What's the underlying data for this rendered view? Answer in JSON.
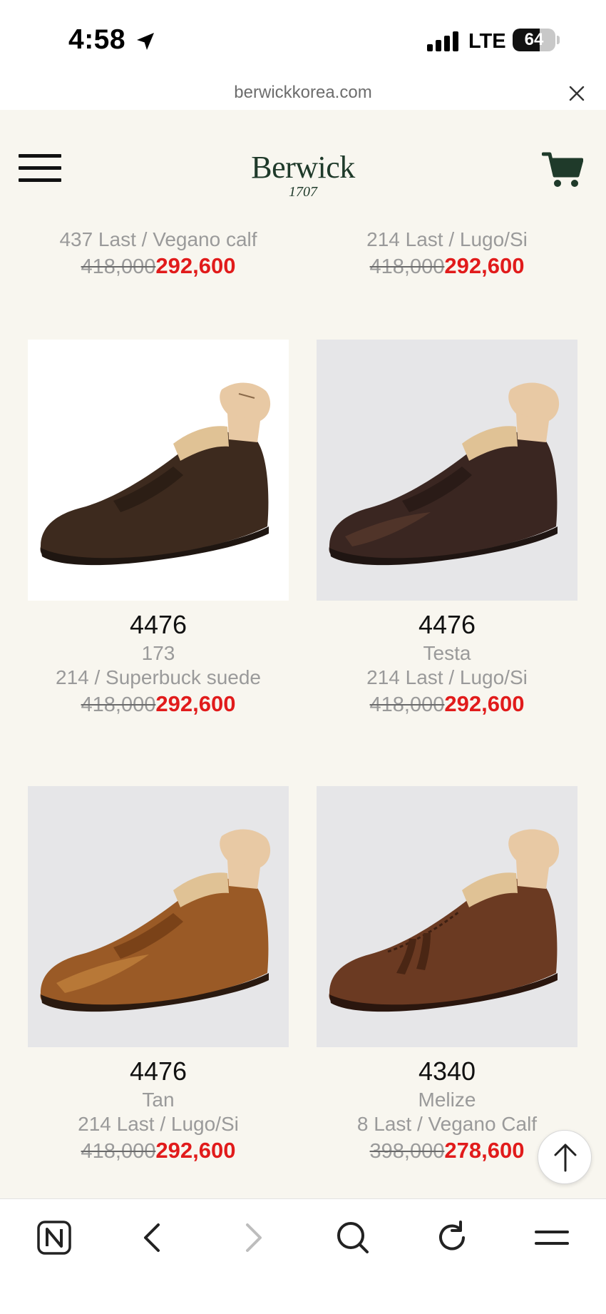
{
  "status_bar": {
    "time": "4:58",
    "network": "LTE",
    "battery": "64",
    "battery_level": 0.64
  },
  "browser": {
    "url": "berwickkorea.com"
  },
  "header": {
    "logo_main": "Berwick",
    "logo_sub": "1707"
  },
  "top_row": [
    {
      "last": "437 Last / Vegano calf",
      "old_price": "418,000",
      "new_price": "292,600"
    },
    {
      "last": "214 Last / Lugo/Si",
      "old_price": "418,000",
      "new_price": "292,600"
    }
  ],
  "products": [
    {
      "model": "4476",
      "name": "173",
      "last": "214 / Superbuck suede",
      "old_price": "418,000",
      "new_price": "292,600"
    },
    {
      "model": "4476",
      "name": "Testa",
      "last": "214 Last / Lugo/Si",
      "old_price": "418,000",
      "new_price": "292,600"
    },
    {
      "model": "4476",
      "name": "Tan",
      "last": "214 Last / Lugo/Si",
      "old_price": "418,000",
      "new_price": "292,600"
    },
    {
      "model": "4340",
      "name": "Melize",
      "last": "8 Last / Vegano Calf",
      "old_price": "398,000",
      "new_price": "278,600"
    }
  ],
  "icons": {
    "location": "location-arrow-icon",
    "close": "close-icon",
    "menu": "hamburger-menu-icon",
    "cart": "cart-icon",
    "scroll_top": "arrow-up-icon",
    "nav": [
      "naver-icon",
      "back-icon",
      "forward-icon",
      "search-icon",
      "reload-icon",
      "menu-icon"
    ]
  },
  "colors": {
    "background": "#f8f6ef",
    "sale_price": "#e11b1b",
    "logo": "#1f3a2a",
    "muted_text": "#9a9a9a"
  }
}
